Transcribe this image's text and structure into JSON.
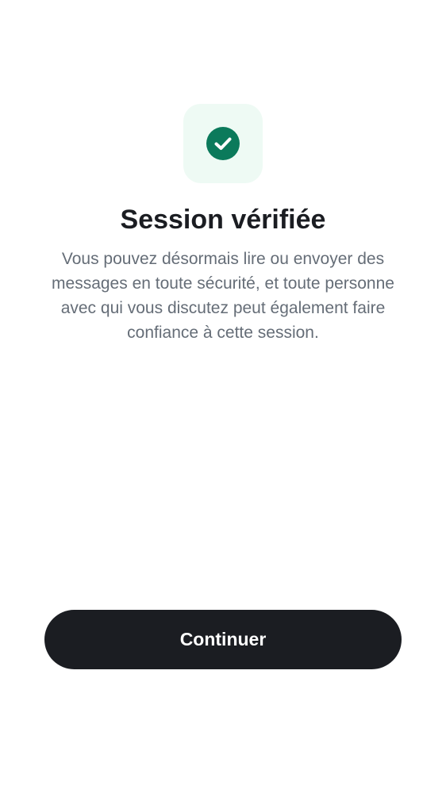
{
  "verification": {
    "title": "Session vérifiée",
    "description": "Vous pouvez désormais lire ou envoyer des messages en toute sécurité, et toute personne avec qui vous discutez peut également faire confiance à cette session.",
    "icon": "checkmark-icon"
  },
  "actions": {
    "continue_label": "Continuer"
  },
  "colors": {
    "success": "#0b7a5b",
    "success_background": "#eefaf4",
    "primary_button": "#1b1d22",
    "title_text": "#1b1d22",
    "body_text": "#656d77"
  }
}
